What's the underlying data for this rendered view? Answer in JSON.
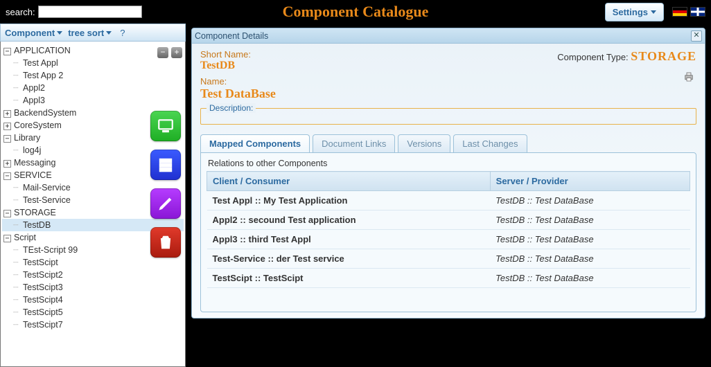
{
  "header": {
    "search_label": "search:",
    "search_value": "",
    "app_title": "Component Catalogue",
    "settings_label": "Settings"
  },
  "toolbar": {
    "component_label": "Component",
    "sort_label": "tree sort",
    "help_label": "?"
  },
  "tree": {
    "nodes": [
      {
        "label": "APPLICATION",
        "expanded": true,
        "children": [
          "Test Appl",
          "Test App 2",
          "Appl2",
          "Appl3"
        ]
      },
      {
        "label": "BackendSystem",
        "expanded": false,
        "children": []
      },
      {
        "label": "CoreSystem",
        "expanded": false,
        "children": []
      },
      {
        "label": "Library",
        "expanded": true,
        "children": [
          "log4j"
        ]
      },
      {
        "label": "Messaging",
        "expanded": false,
        "children": []
      },
      {
        "label": "SERVICE",
        "expanded": true,
        "children": [
          "Mail-Service",
          "Test-Service"
        ]
      },
      {
        "label": "STORAGE",
        "expanded": true,
        "children": [
          "TestDB"
        ]
      },
      {
        "label": "Script",
        "expanded": true,
        "children": [
          "TEst-Script 99",
          "TestScipt",
          "TestScipt2",
          "TestScipt3",
          "TestScipt4",
          "TestScipt5",
          "TestScipt7"
        ]
      }
    ],
    "selected": "TestDB"
  },
  "details": {
    "panel_title": "Component Details",
    "short_name_label": "Short Name:",
    "short_name": "TestDB",
    "name_label": "Name:",
    "name": "Test DataBase",
    "ctype_label": "Component Type:",
    "ctype": "STORAGE",
    "desc_label": "Description:",
    "tabs": [
      "Mapped Components",
      "Document Links",
      "Versions",
      "Last Changes"
    ],
    "active_tab": 0,
    "relations_title": "Relations to other Components",
    "columns": [
      "Client / Consumer",
      "Server / Provider"
    ],
    "rows": [
      {
        "client": "Test Appl :: My Test Application",
        "server": "TestDB :: Test DataBase"
      },
      {
        "client": "Appl2 :: secound Test application",
        "server": "TestDB :: Test DataBase"
      },
      {
        "client": "Appl3 :: third Test Appl",
        "server": "TestDB :: Test DataBase"
      },
      {
        "client": "Test-Service :: der Test service",
        "server": "TestDB :: Test DataBase"
      },
      {
        "client": "TestScipt :: TestScipt",
        "server": "TestDB :: Test DataBase"
      }
    ]
  }
}
